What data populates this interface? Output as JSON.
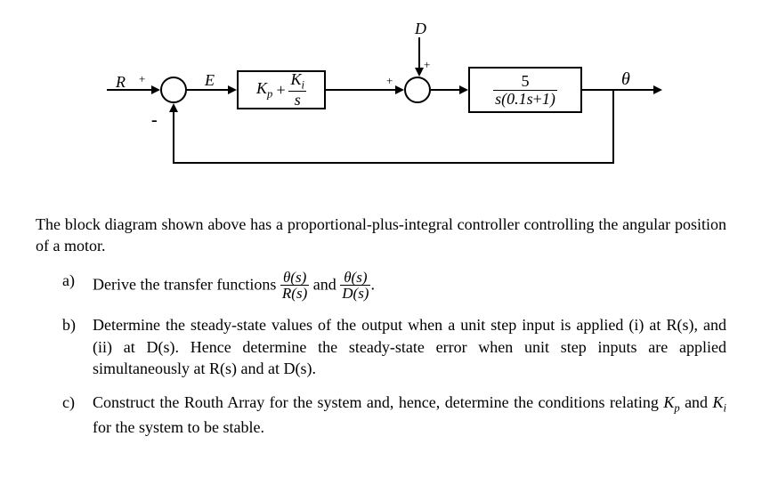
{
  "diagram": {
    "labels": {
      "R": "R",
      "E": "E",
      "D": "D",
      "theta": "θ",
      "plus1a": "+",
      "plus1b": "+",
      "plus2a": "+",
      "minus1": "-"
    },
    "controller": {
      "Kp": "K",
      "Kp_sub": "p",
      "plus": "+",
      "Ki": "K",
      "Ki_sub": "i",
      "over": "s"
    },
    "plant": {
      "num": "5",
      "den_pre": "s(0.1s",
      "den_plus": "+",
      "den_post": "1)"
    }
  },
  "intro": "The block diagram shown above has a proportional-plus-integral controller controlling the angular position of a motor.",
  "qa": {
    "label": "a)",
    "pre": "Derive the transfer functions ",
    "tf1_num": "θ(s)",
    "tf1_den": "R(s)",
    "and": " and ",
    "tf2_num": "θ(s)",
    "tf2_den": "D(s)",
    "post": "."
  },
  "qb": {
    "label": "b)",
    "text": "Determine the steady-state values of the output when a unit step input is applied (i) at R(s), and (ii) at D(s). Hence determine the steady-state error when unit step inputs are applied simultaneously at R(s) and at D(s)."
  },
  "qc": {
    "label": "c)",
    "pre": "Construct the Routh Array for the system and, hence, determine the conditions relating ",
    "Kp": "K",
    "Kp_sub": "p",
    "and": " and ",
    "Ki": "K",
    "Ki_sub": "i",
    "post": " for the system to be stable."
  }
}
